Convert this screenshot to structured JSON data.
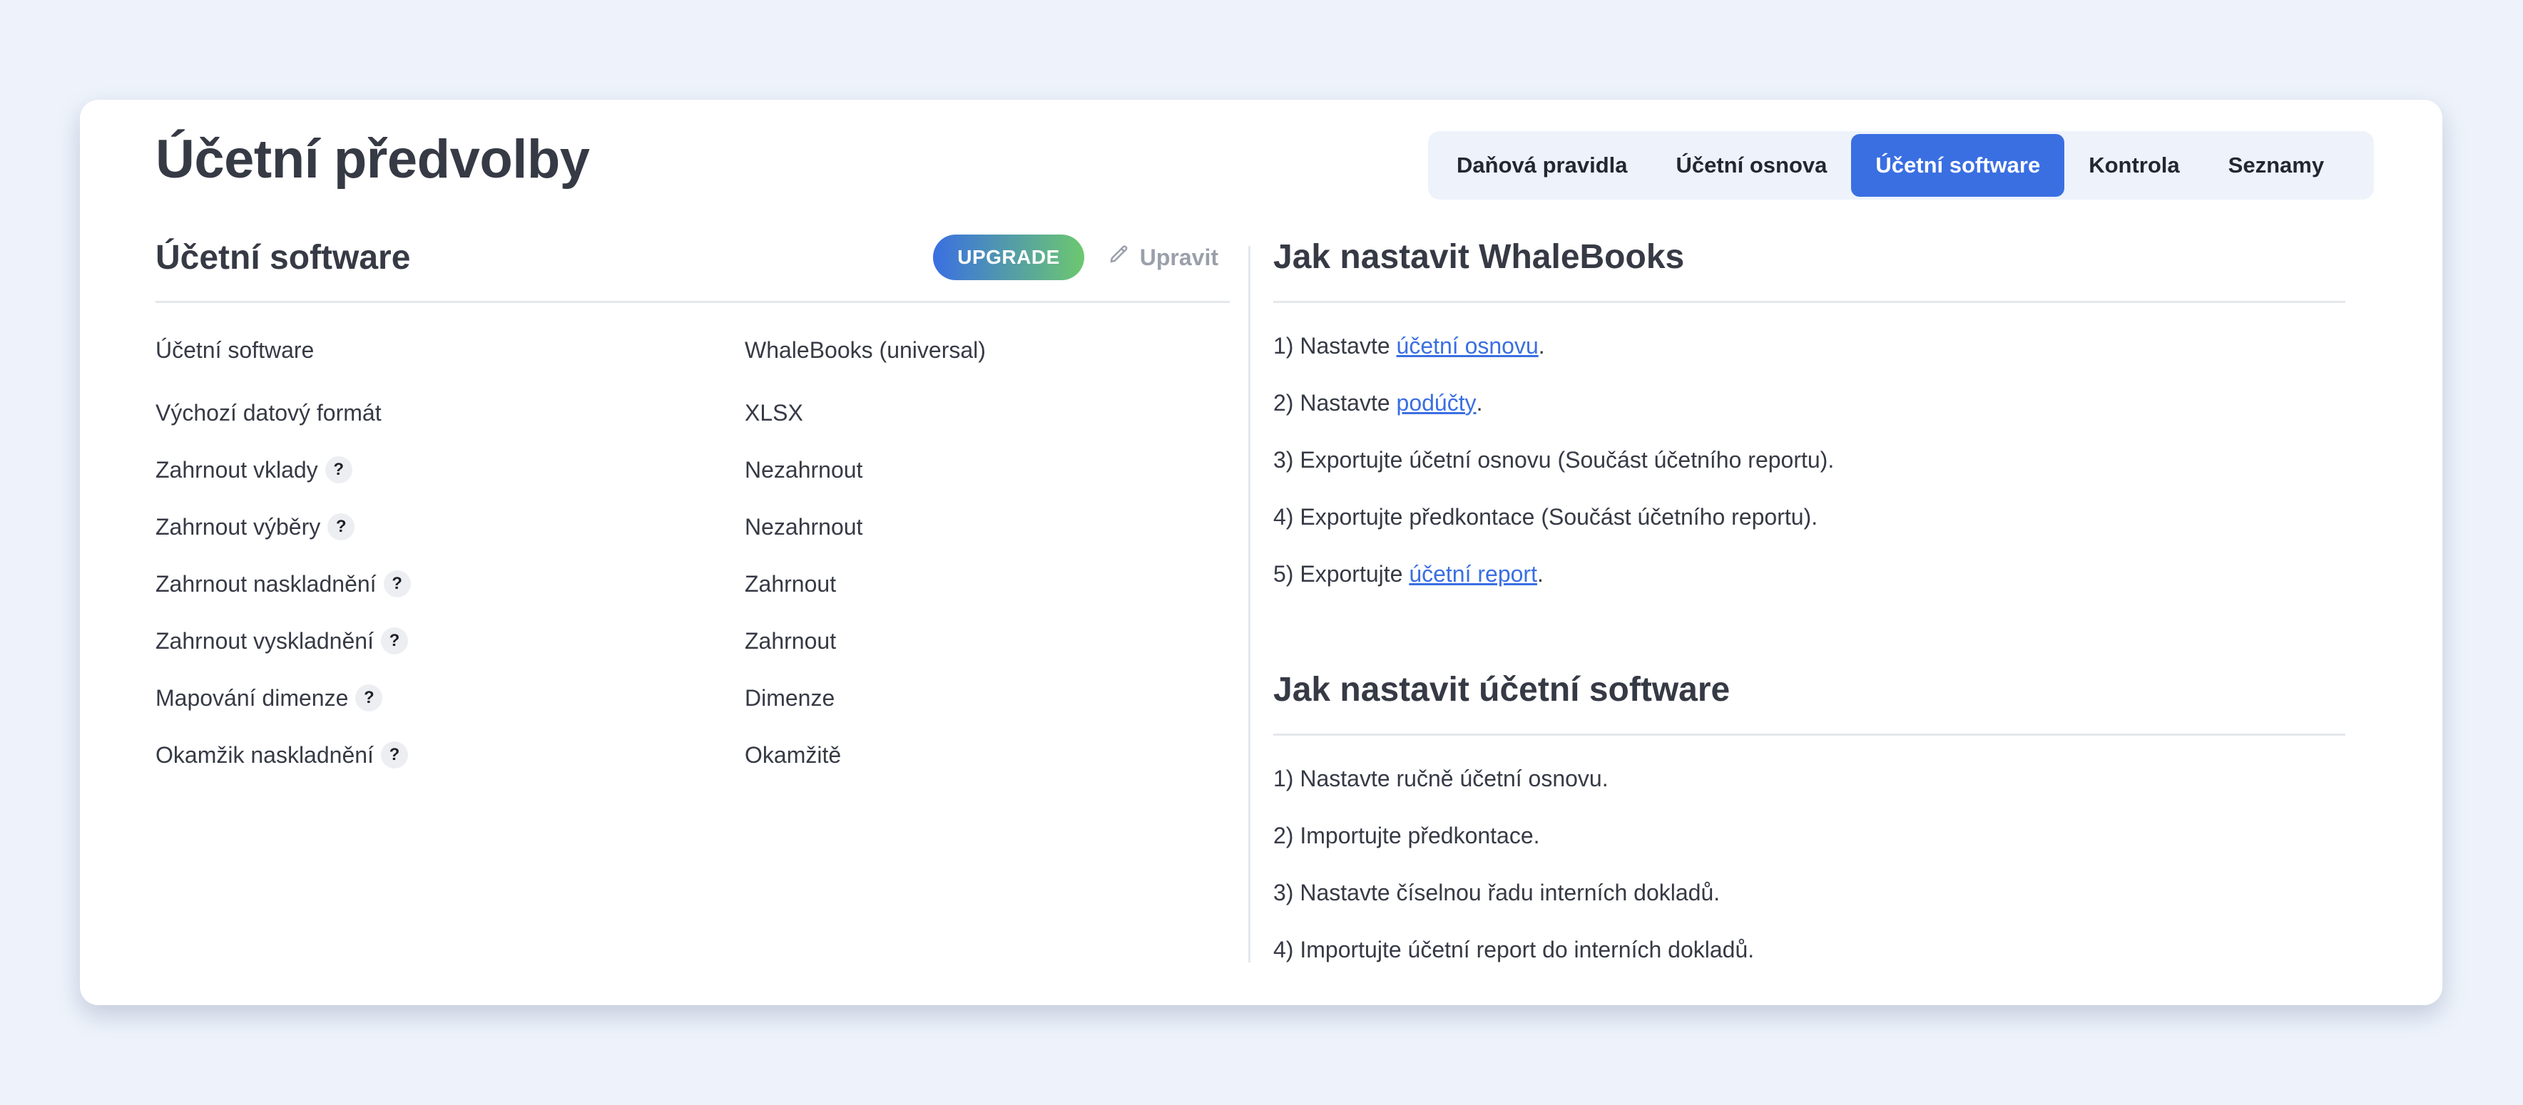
{
  "page": {
    "title": "Účetní předvolby"
  },
  "tabs": [
    {
      "label": "Daňová pravidla",
      "active": false
    },
    {
      "label": "Účetní osnova",
      "active": false
    },
    {
      "label": "Účetní software",
      "active": true
    },
    {
      "label": "Kontrola",
      "active": false
    },
    {
      "label": "Seznamy",
      "active": false
    }
  ],
  "settings": {
    "title": "Účetní software",
    "upgrade_label": "UPGRADE",
    "edit_label": "Upravit",
    "edit_icon": "pencil-icon",
    "help_glyph": "?",
    "rows": [
      {
        "label": "Účetní software",
        "value": "WhaleBooks (universal)",
        "help": false
      },
      {
        "label": "Výchozí datový formát",
        "value": "XLSX",
        "help": false
      },
      {
        "label": "Zahrnout vklady",
        "value": "Nezahrnout",
        "help": true
      },
      {
        "label": "Zahrnout výběry",
        "value": "Nezahrnout",
        "help": true
      },
      {
        "label": "Zahrnout naskladnění",
        "value": "Zahrnout",
        "help": true
      },
      {
        "label": "Zahrnout vyskladnění",
        "value": "Zahrnout",
        "help": true
      },
      {
        "label": "Mapování dimenze",
        "value": "Dimenze",
        "help": true
      },
      {
        "label": "Okamžik naskladnění",
        "value": "Okamžitě",
        "help": true
      }
    ]
  },
  "guide_whalebooks": {
    "title": "Jak nastavit WhaleBooks",
    "steps": [
      {
        "prefix": "1) Nastavte ",
        "link": "účetní osnovu",
        "suffix": "."
      },
      {
        "prefix": "2) Nastavte ",
        "link": "podúčty",
        "suffix": "."
      },
      {
        "prefix": "3) Exportujte účetní osnovu (Součást účetního reportu).",
        "link": "",
        "suffix": ""
      },
      {
        "prefix": "4) Exportujte předkontace (Součást účetního reportu).",
        "link": "",
        "suffix": ""
      },
      {
        "prefix": "5) Exportujte ",
        "link": "účetní report",
        "suffix": "."
      }
    ]
  },
  "guide_software": {
    "title": "Jak nastavit účetní software",
    "steps": [
      "1) Nastavte ručně účetní osnovu.",
      "2) Importujte předkontace.",
      "3) Nastavte číselnou řadu interních dokladů.",
      "4) Importujte účetní report do interních dokladů."
    ]
  },
  "colors": {
    "accent": "#3a6fe2",
    "gradient_end": "#6cc86f",
    "page_bg": "#eef3fb",
    "text": "#363a45",
    "muted": "#9aa0aa"
  }
}
